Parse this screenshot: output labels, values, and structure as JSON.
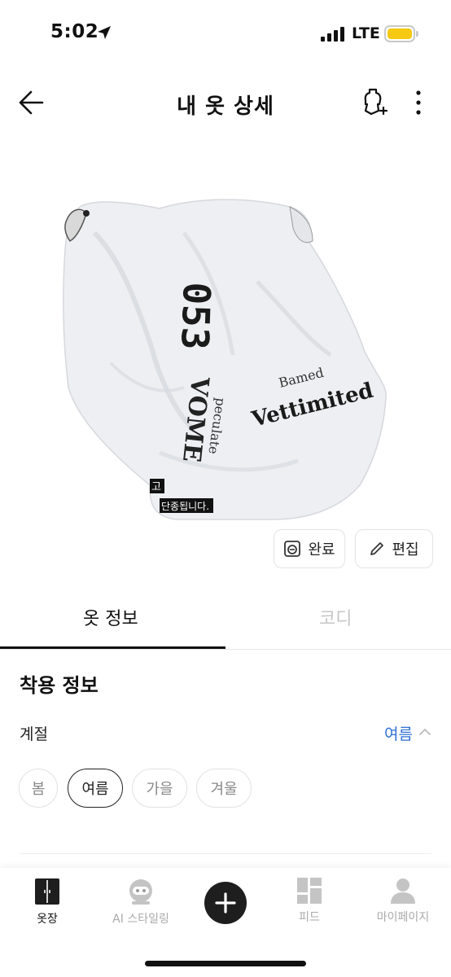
{
  "status_bar": {
    "time": "5:02",
    "network": "LTE"
  },
  "header": {
    "title": "내 옷 상세"
  },
  "image_caption": {
    "line1": "고",
    "line2": "단종됩니다."
  },
  "actions": {
    "done_label": "완료",
    "edit_label": "편집"
  },
  "tabs": [
    {
      "label": "옷 정보",
      "active": true
    },
    {
      "label": "코디",
      "active": false
    }
  ],
  "wear_info": {
    "title": "착용 정보",
    "season_label": "계절",
    "season_value": "여름",
    "seasons": [
      {
        "label": "봄",
        "selected": false
      },
      {
        "label": "여름",
        "selected": true
      },
      {
        "label": "가을",
        "selected": false
      },
      {
        "label": "겨울",
        "selected": false
      }
    ]
  },
  "bottom_nav": {
    "items": [
      {
        "label": "옷장",
        "icon": "wardrobe-icon",
        "active": true
      },
      {
        "label": "AI 스타일링",
        "icon": "robot-icon",
        "active": false
      },
      {
        "label": "피드",
        "icon": "feed-grid-icon",
        "active": false
      },
      {
        "label": "마이페이지",
        "icon": "person-icon",
        "active": false
      }
    ],
    "add_icon": "plus-icon"
  },
  "colors": {
    "accent_blue": "#2f6fd6",
    "battery": "#f6c913",
    "active_text": "#111111",
    "inactive_text": "#aaaaaa"
  }
}
